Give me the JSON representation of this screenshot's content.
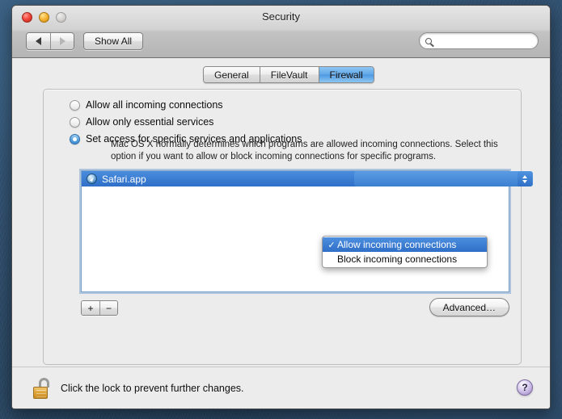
{
  "window": {
    "title": "Security",
    "traffic_lights": [
      "close-button",
      "minimize-button",
      "zoom-button"
    ]
  },
  "toolbar": {
    "back_label": "◀",
    "forward_label": "▶",
    "show_all_label": "Show All",
    "search": {
      "value": "",
      "placeholder": ""
    }
  },
  "tabs": [
    {
      "label": "General",
      "selected": false
    },
    {
      "label": "FileVault",
      "selected": false
    },
    {
      "label": "Firewall",
      "selected": true
    }
  ],
  "firewall": {
    "options": [
      {
        "label": "Allow all incoming connections",
        "selected": false
      },
      {
        "label": "Allow only essential services",
        "selected": false
      },
      {
        "label": "Set access for specific services and applications",
        "selected": true
      }
    ],
    "help_text": "Mac OS X normally determines which programs are allowed incoming connections. Select this option if you want to allow or block incoming connections for specific programs.",
    "app_list": [
      {
        "name": "Safari.app",
        "icon": "safari-compass-icon",
        "selected": true,
        "access_value": "Allow incoming connections"
      }
    ],
    "access_menu": {
      "open": true,
      "items": [
        {
          "label": "Allow incoming connections",
          "checked": true,
          "highlighted": true
        },
        {
          "label": "Block incoming connections",
          "checked": false,
          "highlighted": false
        }
      ],
      "check_glyph": "✓"
    },
    "add_label": "+",
    "remove_label": "−",
    "advanced_label": "Advanced…"
  },
  "lockbar": {
    "icon": "unlocked-padlock-icon",
    "text": "Click the lock to prevent further changes.",
    "help_label": "?"
  },
  "colors": {
    "accent_blue": "#3b7fd0",
    "selection_blue": "#2f6fc8",
    "tab_selected": "#63a9e8",
    "lock_gold": "#dfa63c",
    "help_purple": "#b5a2d6",
    "desktop": "#2c4a67"
  }
}
